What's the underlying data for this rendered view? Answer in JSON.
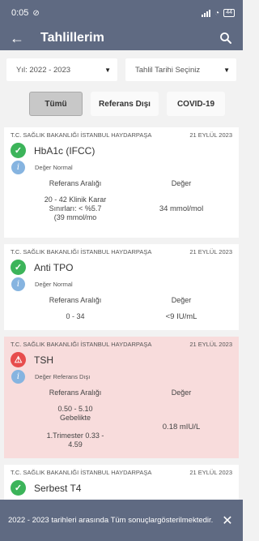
{
  "status_bar": {
    "time": "0:05",
    "battery": "44"
  },
  "app_bar": {
    "title": "Tahlillerim"
  },
  "filters": {
    "year": "Yıl: 2022 - 2023",
    "date": "Tahlil Tarihi Seçiniz"
  },
  "tabs": [
    {
      "label": "Tümü",
      "active": true
    },
    {
      "label": "Referans Dışı",
      "active": false
    },
    {
      "label": "COVID-19",
      "active": false
    }
  ],
  "labels": {
    "ref_header": "Referans Aralığı",
    "val_header": "Değer"
  },
  "results": [
    {
      "lab": "T.C. SAĞLIK BAKANLIĞI İSTANBUL HAYDARPAŞA",
      "date": "21 EYLÜL 2023",
      "name": "HbA1c (IFCC)",
      "value_status": "Değer Normal",
      "reference": "20 - 42 Klinik Karar Sınırları: < %5.7 (39 mmol/mo",
      "value": "34 mmol/mol"
    },
    {
      "lab": "T.C. SAĞLIK BAKANLIĞI İSTANBUL HAYDARPAŞA",
      "date": "21 EYLÜL 2023",
      "name": "Anti TPO",
      "value_status": "Değer Normal",
      "reference": "0 - 34",
      "value": "<9 IU/mL"
    },
    {
      "lab": "T.C. SAĞLIK BAKANLIĞI İSTANBUL HAYDARPAŞA",
      "date": "21 EYLÜL 2023",
      "name": "TSH",
      "value_status": "Değer Referans Dışı",
      "reference": "0.50 - 5.10 Gebelikte\n\n1.Trimester  0.33 - 4.59",
      "value": "0.18 mIU/L"
    },
    {
      "lab": "T.C. SAĞLIK BAKANLIĞI İSTANBUL HAYDARPAŞA",
      "date": "21 EYLÜL 2023",
      "name": "Serbest T4",
      "value_status": "",
      "reference": "",
      "value": ""
    }
  ],
  "snackbar": {
    "message": "2022 - 2023 tarihleri arasında Tüm sonuçlargösterilmektedir."
  },
  "icons": {
    "ok": "check-circle-icon",
    "warn": "warning-triangle-icon",
    "info": "info-icon",
    "back": "arrow-back-icon",
    "search": "search-icon"
  },
  "colors": {
    "primary": "#5f6a82",
    "ok": "#3cb45a",
    "warn": "#e74c4c",
    "info": "#86b4e0",
    "alert_card": "#f8dcdc"
  }
}
